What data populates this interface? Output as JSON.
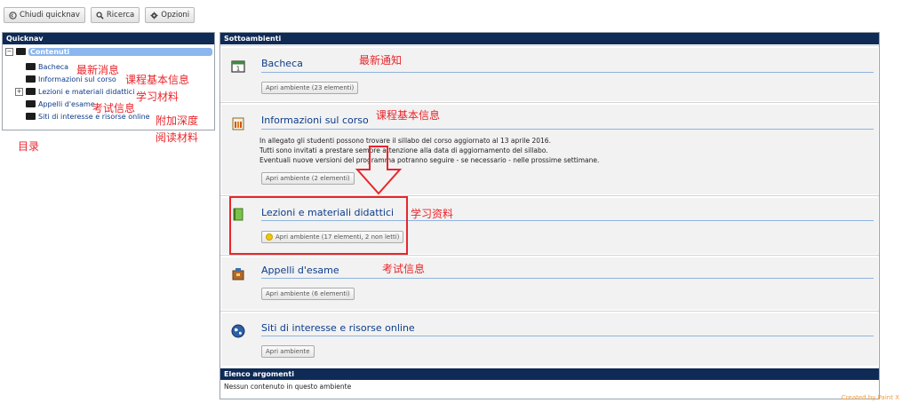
{
  "toolbar": {
    "close_quicknav": "Chiudi quicknav",
    "search": "Ricerca",
    "options": "Opzioni"
  },
  "quicknav": {
    "title": "Quicknav",
    "root": "Contenuti",
    "items": [
      {
        "label": "Bacheca"
      },
      {
        "label": "Informazioni sul corso"
      },
      {
        "label": "Lezioni e materiali didattici"
      },
      {
        "label": "Appelli d'esame"
      },
      {
        "label": "Siti di interesse e risorse online"
      }
    ]
  },
  "annotations": {
    "news_left": "最新消息",
    "course_info_left": "课程基本信息",
    "materials_left": "学习材料",
    "exam_left": "考试信息",
    "extra_reading_1": "附加深度",
    "extra_reading_2": "阅读材料",
    "toc": "目录",
    "news_right": "最新通知",
    "course_info_right": "课程基本信息",
    "materials_right": "学习资料",
    "exam_right": "考试信息"
  },
  "main": {
    "title": "Sottoambienti",
    "sections": [
      {
        "title": "Bacheca",
        "button": "Apri ambiente (23 elementi)"
      },
      {
        "title": "Informazioni sul corso",
        "button": "Apri ambiente (2 elementi)",
        "description": [
          "In allegato gli studenti possono trovare il sillabo del corso aggiornato al 13 aprile 2016.",
          "Tutti sono invitati a prestare sempre attenzione alla data di aggiornamento del sillabo.",
          "Eventuali nuove versioni del programma potranno seguire - se necessario - nelle prossime settimane."
        ]
      },
      {
        "title": "Lezioni e materiali didattici",
        "button": "Apri ambiente (17 elementi, 2 non letti)"
      },
      {
        "title": "Appelli d'esame",
        "button": "Apri ambiente (6 elementi)"
      },
      {
        "title": "Siti di interesse e risorse online",
        "button": "Apri ambiente"
      }
    ],
    "topics_title": "Elenco argomenti",
    "topics_empty": "Nessun contenuto in questo ambiente"
  },
  "footer": "Created by Paint X",
  "colors": {
    "accent": "#0e2a55",
    "annotation": "#e8262b",
    "link": "#0c3c8a"
  }
}
